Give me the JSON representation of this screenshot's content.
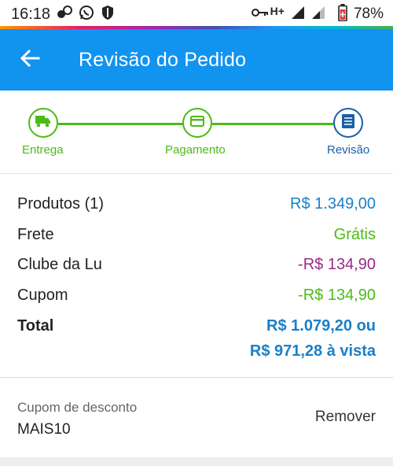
{
  "status_bar": {
    "time": "16:18",
    "network": "H+",
    "battery_percent": "78%",
    "icons": [
      "notification-icon",
      "whatsapp-icon",
      "shield-icon",
      "vpn-key-icon",
      "signal-icon",
      "signal-icon",
      "battery-icon"
    ]
  },
  "app_bar": {
    "title": "Revisão do Pedido",
    "back_icon": "arrow-back-icon",
    "color": "#1193f0"
  },
  "stepper": {
    "steps": [
      {
        "label": "Entrega",
        "icon": "truck-icon",
        "state": "done"
      },
      {
        "label": "Pagamento",
        "icon": "credit-card-icon",
        "state": "done"
      },
      {
        "label": "Revisão",
        "icon": "list-icon",
        "state": "active"
      }
    ],
    "done_color": "#4cbb17",
    "active_color": "#1a5fa8"
  },
  "summary": {
    "products": {
      "label": "Produtos (1)",
      "value": "R$ 1.349,00"
    },
    "shipping": {
      "label": "Frete",
      "value": "Grátis"
    },
    "club": {
      "label": "Clube da Lu",
      "value": "-R$ 134,90"
    },
    "coupon": {
      "label": "Cupom",
      "value": "-R$ 134,90"
    },
    "total": {
      "label": "Total",
      "value_line1": "R$ 1.079,20 ou",
      "value_line2": "R$ 971,28 à vista"
    }
  },
  "coupon_section": {
    "caption": "Cupom de desconto",
    "code": "MAIS10",
    "remove_label": "Remover"
  }
}
